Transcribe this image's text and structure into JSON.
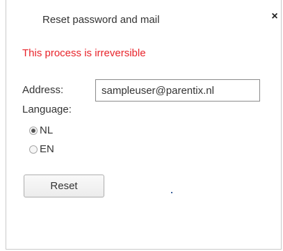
{
  "dialog": {
    "title": "Reset password and mail",
    "close_label": "×"
  },
  "form": {
    "warning": "This process is irreversible",
    "address_label": "Address:",
    "address_value": "sampleuser@parentix.nl",
    "language_label": "Language:",
    "language_options": [
      {
        "label": "NL",
        "selected": true
      },
      {
        "label": "EN",
        "selected": false
      }
    ],
    "reset_label": "Reset"
  },
  "colors": {
    "warning": "#e8232a",
    "text": "#333333",
    "border": "#c9c9c9"
  }
}
